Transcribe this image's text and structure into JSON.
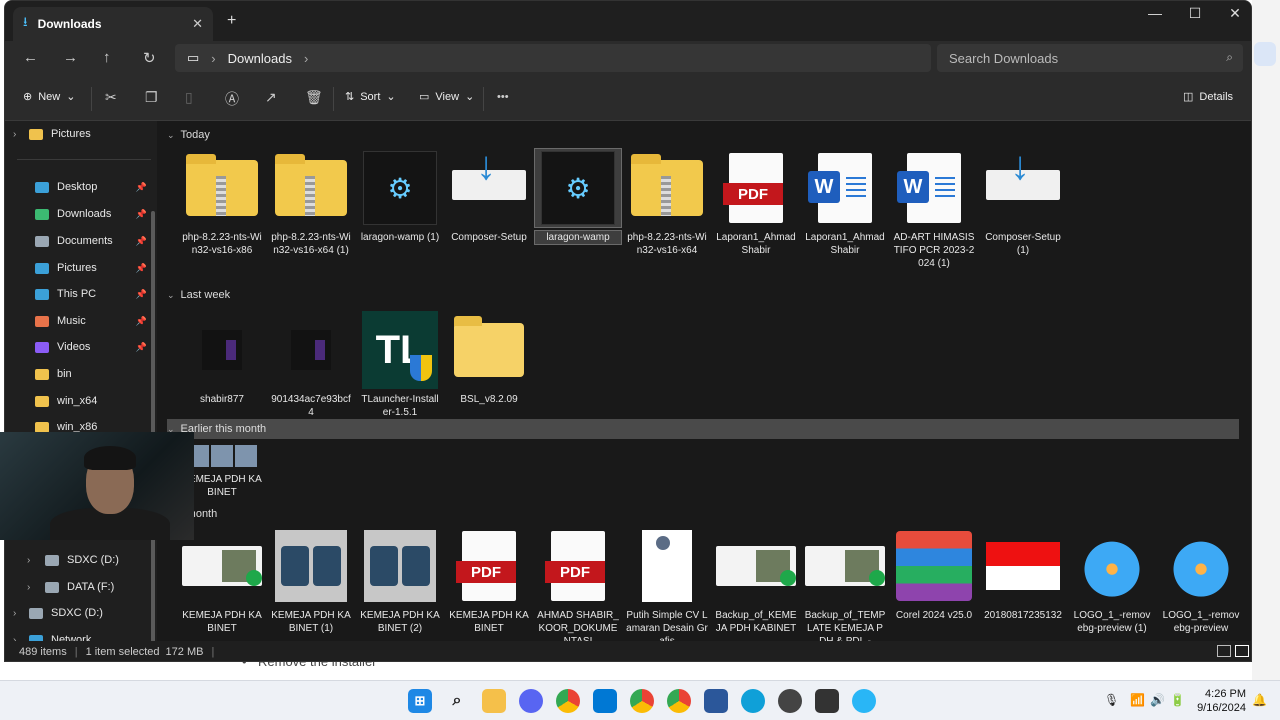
{
  "tab": {
    "title": "Downloads",
    "add": "+"
  },
  "window_controls": {
    "minimize": "—",
    "maximize": "☐",
    "close": "✕"
  },
  "address": {
    "location": "Downloads",
    "search_placeholder": "Search Downloads"
  },
  "commands": {
    "new": "New",
    "sort": "Sort",
    "view": "View",
    "more": "•••",
    "details": "Details"
  },
  "sidebar": {
    "items": [
      {
        "label": "Pictures",
        "color": "#f0c24d"
      },
      {
        "label": "Desktop",
        "color": "#3ba0d8"
      },
      {
        "label": "Downloads",
        "color": "#3cba72"
      },
      {
        "label": "Documents",
        "color": "#9aa7b3"
      },
      {
        "label": "Pictures",
        "color": "#3ba0d8"
      },
      {
        "label": "This PC",
        "color": "#3ba0d8"
      },
      {
        "label": "Music",
        "color": "#e8734a"
      },
      {
        "label": "Videos",
        "color": "#8b5cf6"
      },
      {
        "label": "bin",
        "color": "#f0c24d"
      },
      {
        "label": "win_x64",
        "color": "#f0c24d"
      },
      {
        "label": "win_x86",
        "color": "#f0c24d"
      },
      {
        "label": "SDXC (D:)",
        "color": "#9aa7b3"
      },
      {
        "label": "DATA (F:)",
        "color": "#9aa7b3"
      },
      {
        "label": "SDXC (D:)",
        "color": "#9aa7b3"
      },
      {
        "label": "Network",
        "color": "#3ba0d8"
      }
    ]
  },
  "groups": {
    "today": "Today",
    "last_week": "Last week",
    "earlier": "Earlier this month",
    "last_month": "t month"
  },
  "today_items": [
    {
      "name": "php-8.2.23-nts-Win32-vs16-x86",
      "icon": "zip-icon"
    },
    {
      "name": "php-8.2.23-nts-Win32-vs16-x64 (1)",
      "icon": "zip-icon"
    },
    {
      "name": "laragon-wamp (1)",
      "icon": "installer-icon"
    },
    {
      "name": "Composer-Setup",
      "icon": "download-icon"
    },
    {
      "name": "laragon-wamp",
      "icon": "installer-icon"
    },
    {
      "name": "php-8.2.23-nts-Win32-vs16-x64",
      "icon": "zip-icon"
    },
    {
      "name": "Laporan1_Ahmad Shabir",
      "icon": "pdf-icon"
    },
    {
      "name": "Laporan1_Ahmad Shabir",
      "icon": "word-icon"
    },
    {
      "name": "AD-ART HIMASISTIFO PCR 2023-2024 (1)",
      "icon": "word-icon"
    },
    {
      "name": "Composer-Setup (1)",
      "icon": "download-icon"
    }
  ],
  "lastweek_items": [
    {
      "name": "shabir877"
    },
    {
      "name": "901434ac7e93bcf4"
    },
    {
      "name": "TLauncher-Installer-1.5.1",
      "icon_text": "TL"
    },
    {
      "name": "BSL_v8.2.09"
    }
  ],
  "earlier_items": [
    {
      "name": "KEMEJA PDH KABINET"
    }
  ],
  "lastmonth_items": [
    {
      "name": "KEMEJA PDH KABINET"
    },
    {
      "name": "KEMEJA PDH KABINET (1)"
    },
    {
      "name": "KEMEJA PDH KABINET (2)"
    },
    {
      "name": "KEMEJA PDH KABINET"
    },
    {
      "name": "AHMAD SHABIR_KOOR_DOKUMENTASI"
    },
    {
      "name": "Putih Simple CV Lamaran Desain Grafis"
    },
    {
      "name": "Backup_of_KEMEJA PDH KABINET"
    },
    {
      "name": "Backup_of_TEMPLATE KEMEJA PDH & PDL -"
    },
    {
      "name": "Corel 2024 v25.0"
    },
    {
      "name": "20180817235132"
    },
    {
      "name": "LOGO_1_-removebg-preview (1)"
    },
    {
      "name": "LOGO_1_-removebg-preview"
    }
  ],
  "pdf_label": "PDF",
  "word_label": "W",
  "status": {
    "items": "489 items",
    "selected": "1 item selected",
    "size": "172 MB"
  },
  "background": {
    "bullet": "Remove the installer"
  },
  "clock": {
    "time": "4:26 PM",
    "date": "9/16/2024"
  }
}
